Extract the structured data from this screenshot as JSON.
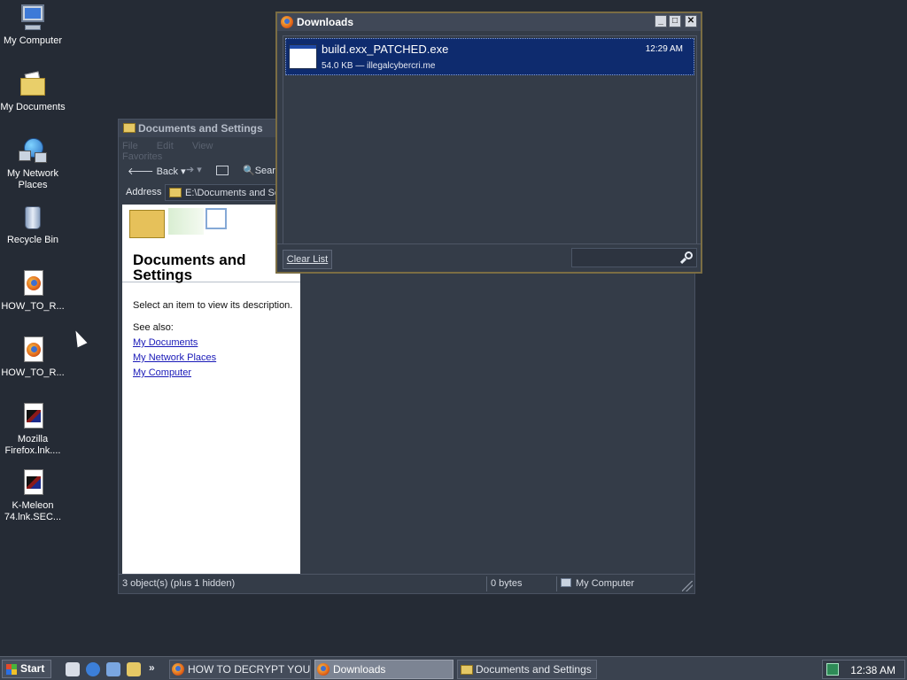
{
  "desktop": {
    "icons": [
      {
        "label": "My Computer",
        "icon": "my-computer-icon"
      },
      {
        "label": "My Documents",
        "icon": "my-documents-icon"
      },
      {
        "label": "My Network Places",
        "icon": "network-places-icon"
      },
      {
        "label": "Recycle Bin",
        "icon": "recycle-bin-icon"
      },
      {
        "label": "HOW_TO_R...",
        "icon": "firefox-html-file-icon"
      },
      {
        "label": "HOW_TO_R...",
        "icon": "firefox-html-file-icon"
      },
      {
        "label": "Mozilla Firefox.lnk....",
        "icon": "shortcut-file-icon"
      },
      {
        "label": "K-Meleon 74.lnk.SEC...",
        "icon": "shortcut-file-icon"
      }
    ]
  },
  "explorer": {
    "title": "Documents and Settings",
    "menu": [
      "File",
      "Edit",
      "View",
      "Favorites"
    ],
    "toolbar": {
      "back": "Back",
      "search": "Sear"
    },
    "address_label": "Address",
    "address_value": "E:\\Documents and Se",
    "taskpane": {
      "title": "Documents and Settings",
      "description": "Select an item to view its description.",
      "see_also": "See also:",
      "links": [
        "My Documents",
        "My Network Places",
        "My Computer"
      ]
    },
    "status": {
      "objects": "3 object(s) (plus 1 hidden)",
      "size": "0 bytes",
      "location": "My Computer"
    }
  },
  "downloads": {
    "title": "Downloads",
    "items": [
      {
        "filename": "build.exx_PATCHED.exe",
        "meta": "54.0 KB — illegalcybercri.me",
        "time": "12:29 AM"
      }
    ],
    "clear_label": "Clear List",
    "search_placeholder": ""
  },
  "taskbar": {
    "start_label": "Start",
    "quicklaunch_more": "»",
    "tasks": [
      {
        "label": "HOW TO DECRYPT YOUR ...",
        "active": false
      },
      {
        "label": "Downloads",
        "active": true
      },
      {
        "label": "Documents and Settings",
        "active": false
      }
    ],
    "clock": "12:38 AM"
  },
  "colors": {
    "desktop_bg": "#252b35",
    "selection": "#0e2b6e",
    "link": "#1a1ab8",
    "downloads_border": "#7b6d43"
  }
}
